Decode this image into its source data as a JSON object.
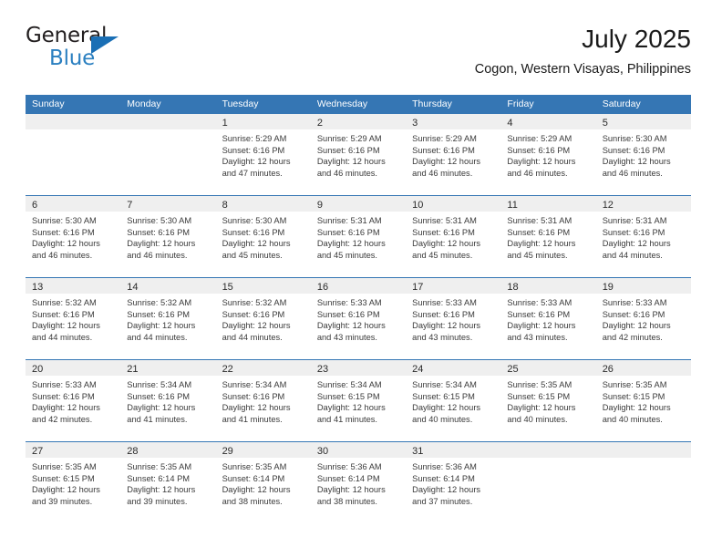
{
  "brand": {
    "name_part1": "General",
    "name_part2": "Blue",
    "triangle_icon": "triangle-icon",
    "accent_color": "#2a7fc0"
  },
  "header": {
    "title": "July 2025",
    "subtitle": "Cogon, Western Visayas, Philippines"
  },
  "theme": {
    "header_blue": "#3576b4",
    "day_band_gray": "#efefef"
  },
  "calendar": {
    "weekday_headers": [
      "Sunday",
      "Monday",
      "Tuesday",
      "Wednesday",
      "Thursday",
      "Friday",
      "Saturday"
    ],
    "weeks": [
      [
        {
          "day": "",
          "lines": []
        },
        {
          "day": "",
          "lines": []
        },
        {
          "day": "1",
          "lines": [
            "Sunrise: 5:29 AM",
            "Sunset: 6:16 PM",
            "Daylight: 12 hours",
            "and 47 minutes."
          ]
        },
        {
          "day": "2",
          "lines": [
            "Sunrise: 5:29 AM",
            "Sunset: 6:16 PM",
            "Daylight: 12 hours",
            "and 46 minutes."
          ]
        },
        {
          "day": "3",
          "lines": [
            "Sunrise: 5:29 AM",
            "Sunset: 6:16 PM",
            "Daylight: 12 hours",
            "and 46 minutes."
          ]
        },
        {
          "day": "4",
          "lines": [
            "Sunrise: 5:29 AM",
            "Sunset: 6:16 PM",
            "Daylight: 12 hours",
            "and 46 minutes."
          ]
        },
        {
          "day": "5",
          "lines": [
            "Sunrise: 5:30 AM",
            "Sunset: 6:16 PM",
            "Daylight: 12 hours",
            "and 46 minutes."
          ]
        }
      ],
      [
        {
          "day": "6",
          "lines": [
            "Sunrise: 5:30 AM",
            "Sunset: 6:16 PM",
            "Daylight: 12 hours",
            "and 46 minutes."
          ]
        },
        {
          "day": "7",
          "lines": [
            "Sunrise: 5:30 AM",
            "Sunset: 6:16 PM",
            "Daylight: 12 hours",
            "and 46 minutes."
          ]
        },
        {
          "day": "8",
          "lines": [
            "Sunrise: 5:30 AM",
            "Sunset: 6:16 PM",
            "Daylight: 12 hours",
            "and 45 minutes."
          ]
        },
        {
          "day": "9",
          "lines": [
            "Sunrise: 5:31 AM",
            "Sunset: 6:16 PM",
            "Daylight: 12 hours",
            "and 45 minutes."
          ]
        },
        {
          "day": "10",
          "lines": [
            "Sunrise: 5:31 AM",
            "Sunset: 6:16 PM",
            "Daylight: 12 hours",
            "and 45 minutes."
          ]
        },
        {
          "day": "11",
          "lines": [
            "Sunrise: 5:31 AM",
            "Sunset: 6:16 PM",
            "Daylight: 12 hours",
            "and 45 minutes."
          ]
        },
        {
          "day": "12",
          "lines": [
            "Sunrise: 5:31 AM",
            "Sunset: 6:16 PM",
            "Daylight: 12 hours",
            "and 44 minutes."
          ]
        }
      ],
      [
        {
          "day": "13",
          "lines": [
            "Sunrise: 5:32 AM",
            "Sunset: 6:16 PM",
            "Daylight: 12 hours",
            "and 44 minutes."
          ]
        },
        {
          "day": "14",
          "lines": [
            "Sunrise: 5:32 AM",
            "Sunset: 6:16 PM",
            "Daylight: 12 hours",
            "and 44 minutes."
          ]
        },
        {
          "day": "15",
          "lines": [
            "Sunrise: 5:32 AM",
            "Sunset: 6:16 PM",
            "Daylight: 12 hours",
            "and 44 minutes."
          ]
        },
        {
          "day": "16",
          "lines": [
            "Sunrise: 5:33 AM",
            "Sunset: 6:16 PM",
            "Daylight: 12 hours",
            "and 43 minutes."
          ]
        },
        {
          "day": "17",
          "lines": [
            "Sunrise: 5:33 AM",
            "Sunset: 6:16 PM",
            "Daylight: 12 hours",
            "and 43 minutes."
          ]
        },
        {
          "day": "18",
          "lines": [
            "Sunrise: 5:33 AM",
            "Sunset: 6:16 PM",
            "Daylight: 12 hours",
            "and 43 minutes."
          ]
        },
        {
          "day": "19",
          "lines": [
            "Sunrise: 5:33 AM",
            "Sunset: 6:16 PM",
            "Daylight: 12 hours",
            "and 42 minutes."
          ]
        }
      ],
      [
        {
          "day": "20",
          "lines": [
            "Sunrise: 5:33 AM",
            "Sunset: 6:16 PM",
            "Daylight: 12 hours",
            "and 42 minutes."
          ]
        },
        {
          "day": "21",
          "lines": [
            "Sunrise: 5:34 AM",
            "Sunset: 6:16 PM",
            "Daylight: 12 hours",
            "and 41 minutes."
          ]
        },
        {
          "day": "22",
          "lines": [
            "Sunrise: 5:34 AM",
            "Sunset: 6:16 PM",
            "Daylight: 12 hours",
            "and 41 minutes."
          ]
        },
        {
          "day": "23",
          "lines": [
            "Sunrise: 5:34 AM",
            "Sunset: 6:15 PM",
            "Daylight: 12 hours",
            "and 41 minutes."
          ]
        },
        {
          "day": "24",
          "lines": [
            "Sunrise: 5:34 AM",
            "Sunset: 6:15 PM",
            "Daylight: 12 hours",
            "and 40 minutes."
          ]
        },
        {
          "day": "25",
          "lines": [
            "Sunrise: 5:35 AM",
            "Sunset: 6:15 PM",
            "Daylight: 12 hours",
            "and 40 minutes."
          ]
        },
        {
          "day": "26",
          "lines": [
            "Sunrise: 5:35 AM",
            "Sunset: 6:15 PM",
            "Daylight: 12 hours",
            "and 40 minutes."
          ]
        }
      ],
      [
        {
          "day": "27",
          "lines": [
            "Sunrise: 5:35 AM",
            "Sunset: 6:15 PM",
            "Daylight: 12 hours",
            "and 39 minutes."
          ]
        },
        {
          "day": "28",
          "lines": [
            "Sunrise: 5:35 AM",
            "Sunset: 6:14 PM",
            "Daylight: 12 hours",
            "and 39 minutes."
          ]
        },
        {
          "day": "29",
          "lines": [
            "Sunrise: 5:35 AM",
            "Sunset: 6:14 PM",
            "Daylight: 12 hours",
            "and 38 minutes."
          ]
        },
        {
          "day": "30",
          "lines": [
            "Sunrise: 5:36 AM",
            "Sunset: 6:14 PM",
            "Daylight: 12 hours",
            "and 38 minutes."
          ]
        },
        {
          "day": "31",
          "lines": [
            "Sunrise: 5:36 AM",
            "Sunset: 6:14 PM",
            "Daylight: 12 hours",
            "and 37 minutes."
          ]
        },
        {
          "day": "",
          "lines": []
        },
        {
          "day": "",
          "lines": []
        }
      ]
    ]
  }
}
